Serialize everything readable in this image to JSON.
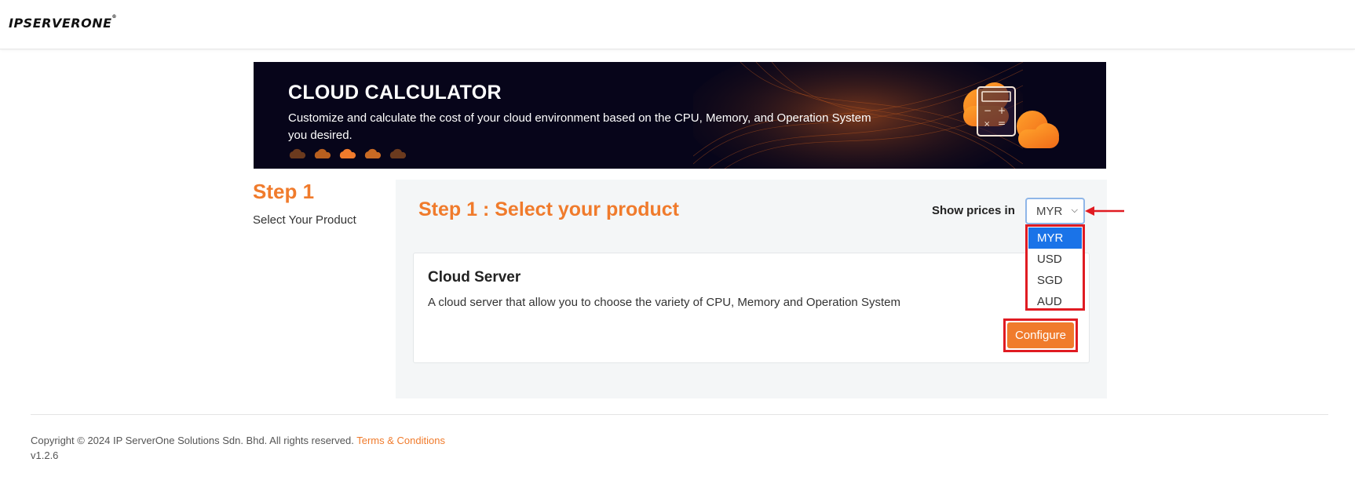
{
  "header": {
    "logo_text": "IPSERVERONE",
    "logo_mark": "®"
  },
  "banner": {
    "title": "CLOUD CALCULATOR",
    "description": "Customize and calculate the cost of your cloud environment based on the CPU, Memory, and Operation System you desired.",
    "cloud_dot_colors": [
      "#6b3a1e",
      "#b85f1f",
      "#f07b2c",
      "#c86a24",
      "#6b3a1e"
    ]
  },
  "step": {
    "title": "Step 1",
    "subtitle": "Select Your Product"
  },
  "panel": {
    "title": "Step 1 : Select your product",
    "price_label": "Show prices in",
    "currency_selected": "MYR",
    "currency_options": [
      "MYR",
      "USD",
      "SGD",
      "AUD"
    ]
  },
  "product_card": {
    "title": "Cloud Server",
    "description": "A cloud server that allow you to choose the variety of CPU, Memory and Operation System",
    "configure_label": "Configure"
  },
  "footer": {
    "copyright": "Copyright © 2024 IP ServerOne Solutions Sdn. Bhd. All rights reserved.",
    "terms_link": "Terms & Conditions",
    "version": "v1.2.6"
  },
  "colors": {
    "accent": "#f07b2c",
    "highlight": "#e01b22",
    "banner_bg": "#07051a",
    "selected_option": "#1a73e8"
  }
}
